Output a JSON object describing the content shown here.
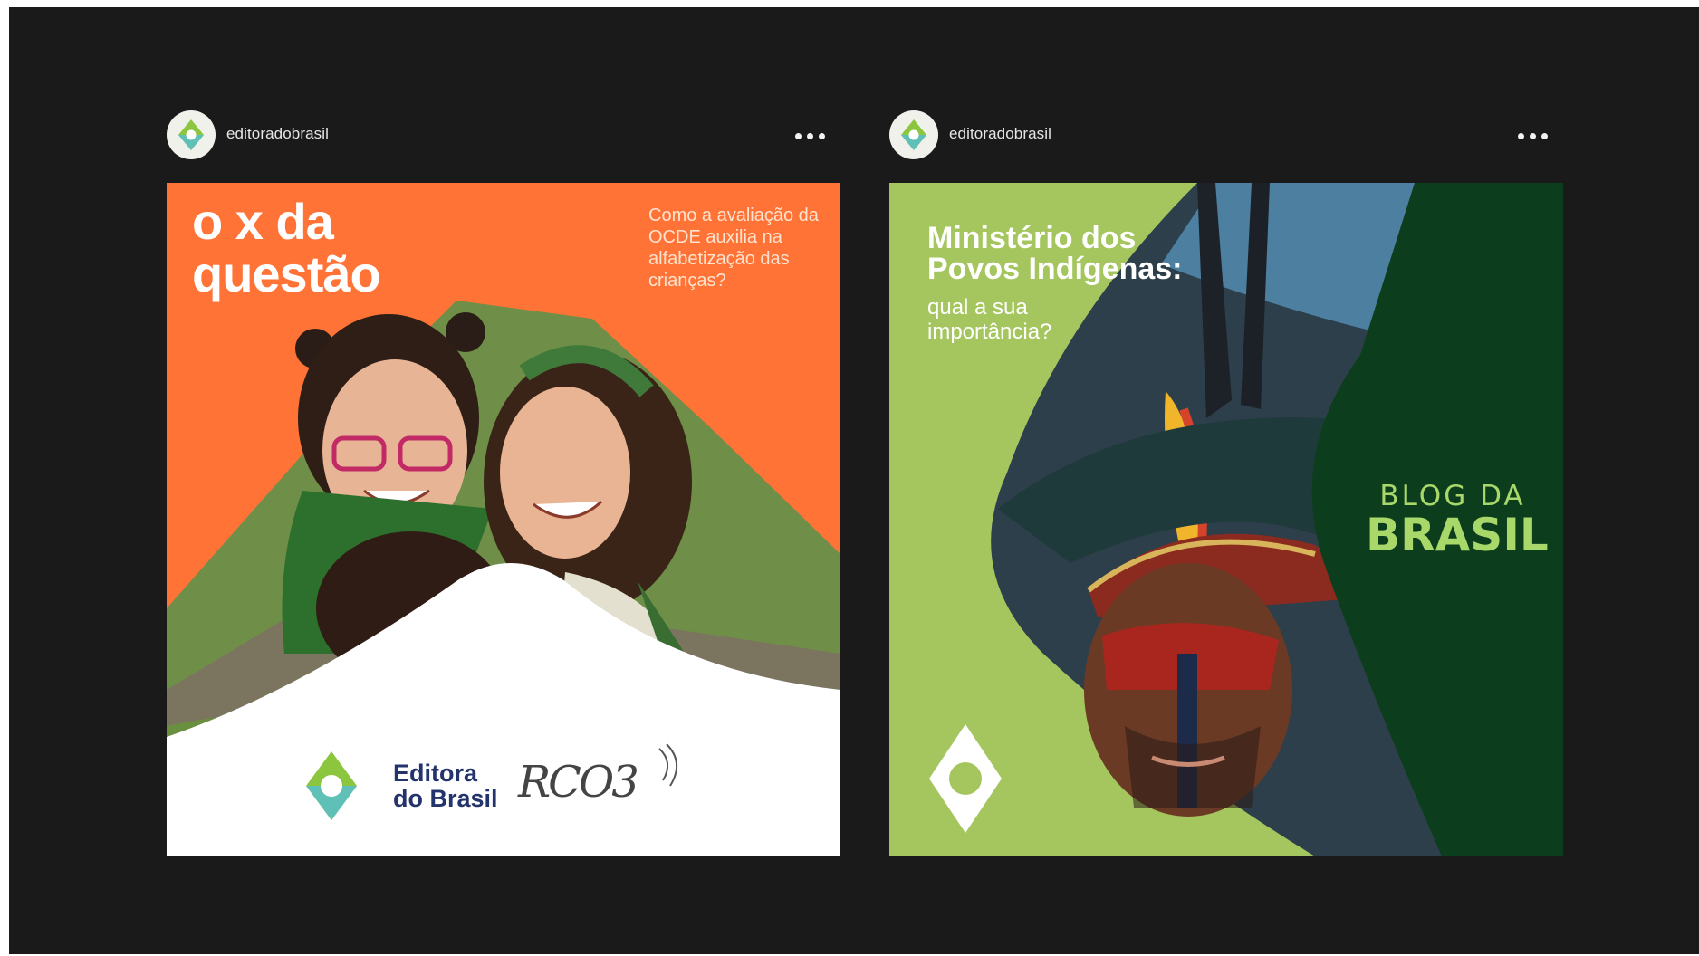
{
  "posts": [
    {
      "username": "editoradobrasil",
      "more_icon": "more-horizontal-icon",
      "image": {
        "headline": "o x da\nquestão",
        "side_text": "Como a avaliação da OCDE auxilia na alfabetização das crianças?",
        "brand_logo_text": "Editora\ndo Brasil",
        "podcast_logo_text": "RCO3",
        "colors": {
          "background": "#ff7337",
          "bottom_panel": "#ffffff",
          "brand_text": "#23336b"
        }
      }
    },
    {
      "username": "editoradobrasil",
      "more_icon": "more-horizontal-icon",
      "image": {
        "title": "Ministério dos\nPovos Indígenas:",
        "subtitle": "qual a sua\nimportância?",
        "blog_line1": "BLOG DA",
        "blog_line2": "BRASIL",
        "colors": {
          "left_panel": "#a5c65e",
          "right_panel": "#0c3d1c",
          "blog_text": "#a8d76a"
        }
      }
    }
  ],
  "colors": {
    "stage_background": "#1a1a1a",
    "username_text": "#e6e6e6"
  }
}
